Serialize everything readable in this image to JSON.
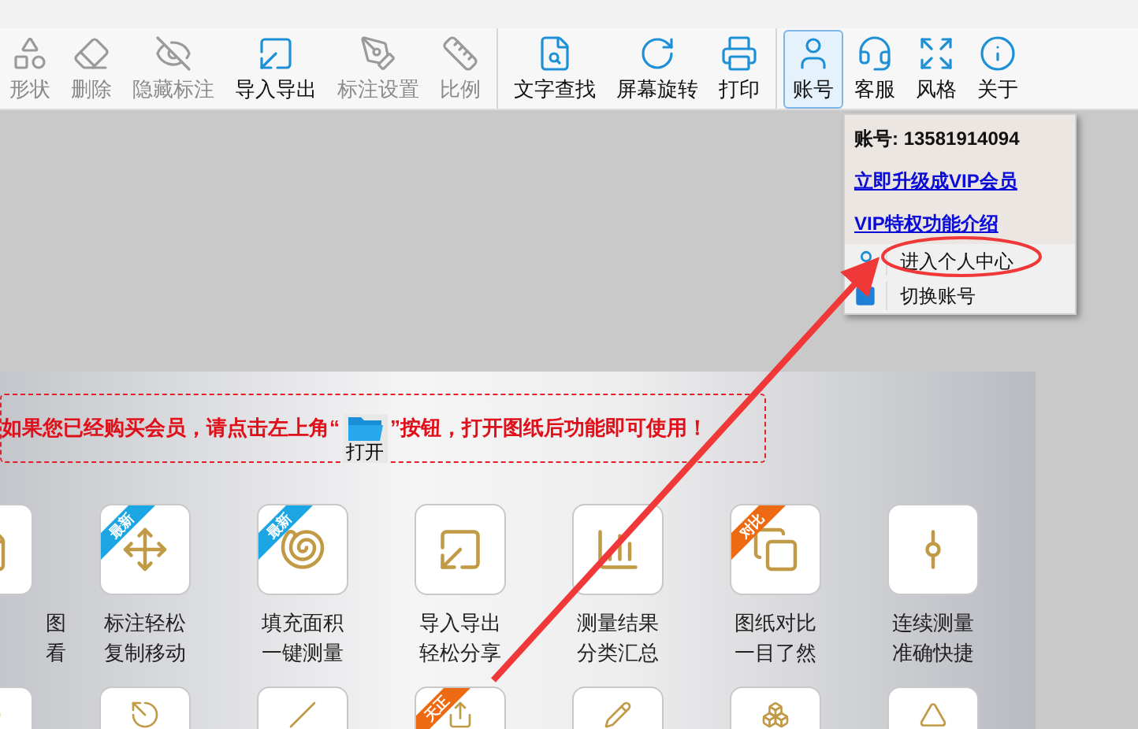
{
  "toolbar": {
    "groups": [
      {
        "items": [
          {
            "label": "形状",
            "kind": "shape",
            "disabled": true,
            "selected": false
          },
          {
            "label": "删除",
            "kind": "eraser",
            "disabled": true,
            "selected": false
          },
          {
            "label": "隐藏标注",
            "kind": "eye-off",
            "disabled": true,
            "selected": false
          },
          {
            "label": "导入导出",
            "kind": "export",
            "disabled": false,
            "selected": false
          },
          {
            "label": "标注设置",
            "kind": "pen-gear",
            "disabled": true,
            "selected": false
          },
          {
            "label": "比例",
            "kind": "ruler",
            "disabled": true,
            "selected": false
          }
        ]
      },
      {
        "items": [
          {
            "label": "文字查找",
            "kind": "search-doc",
            "disabled": false,
            "selected": false
          },
          {
            "label": "屏幕旋转",
            "kind": "rotate",
            "disabled": false,
            "selected": false
          },
          {
            "label": "打印",
            "kind": "printer",
            "disabled": false,
            "selected": false
          }
        ]
      },
      {
        "items": [
          {
            "label": "账号",
            "kind": "user",
            "disabled": false,
            "selected": true
          },
          {
            "label": "客服",
            "kind": "headset",
            "disabled": false,
            "selected": false
          },
          {
            "label": "风格",
            "kind": "expand",
            "disabled": false,
            "selected": false
          },
          {
            "label": "关于",
            "kind": "info",
            "disabled": false,
            "selected": false
          }
        ]
      }
    ]
  },
  "account_menu": {
    "account": "账号: 13581914094",
    "links": [
      "立即升级成VIP会员",
      "VIP特权功能介绍"
    ],
    "items": [
      {
        "label": "进入个人中心",
        "kind": "user"
      },
      {
        "label": "切换账号",
        "kind": "switch"
      }
    ]
  },
  "notice": {
    "before": "如果您已经购买会员，请点击左上角“",
    "button": "打开",
    "after": "”按钮，打开图纸后功能即可使用！"
  },
  "features": [
    {
      "kind": "doc",
      "lines": [
        "图",
        "看"
      ]
    },
    {
      "kind": "move",
      "lines": [
        "标注轻松",
        "复制移动"
      ],
      "badge": {
        "text": "最新",
        "color": "#1ba6e3"
      }
    },
    {
      "kind": "fill",
      "lines": [
        "填充面积",
        "一键测量"
      ],
      "badge": {
        "text": "最新",
        "color": "#1ba6e3"
      }
    },
    {
      "kind": "export",
      "lines": [
        "导入导出",
        "轻松分享"
      ]
    },
    {
      "kind": "chart",
      "lines": [
        "测量结果",
        "分类汇总"
      ]
    },
    {
      "kind": "compare",
      "lines": [
        "图纸对比",
        "一目了然"
      ],
      "badge": {
        "text": "对比",
        "color": "#ee6a12"
      }
    },
    {
      "kind": "path",
      "lines": [
        "连续测量",
        "准确快捷"
      ]
    }
  ],
  "features_row2": [
    {
      "kind": "circle"
    },
    {
      "kind": "compass"
    },
    {
      "kind": "line"
    },
    {
      "kind": "share",
      "badge": {
        "text": "天正",
        "color": "#ee6a12"
      }
    },
    {
      "kind": "pencil"
    },
    {
      "kind": "blocks"
    },
    {
      "kind": "triangle"
    }
  ]
}
